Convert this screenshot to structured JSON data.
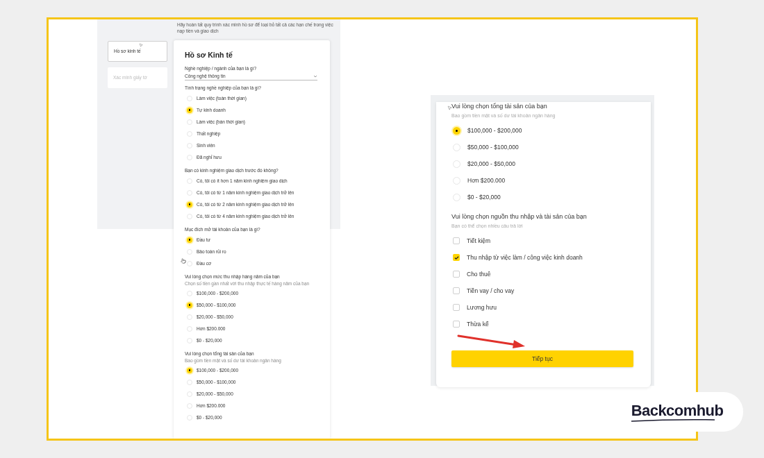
{
  "left_screen": {
    "intro": "Hãy hoàn tất quy trình xác minh hồ sơ để loại bỏ tất cả các hạn chế trong việc nạp tiền và giao dịch",
    "sidebar": [
      {
        "label": "Hồ sơ kinh tế",
        "selected": true
      },
      {
        "label": "Xác minh giấy tờ",
        "selected": false
      }
    ],
    "form": {
      "title": "Hồ sơ Kinh tế",
      "occupation": {
        "label": "Nghề nghiệp / ngành của bạn là gì?",
        "value": "Công nghệ thông tin"
      },
      "questions": [
        {
          "kind": "radio",
          "label": "Tình trạng nghề nghiệp của bạn là gì?",
          "options": [
            {
              "label": "Làm việc (toàn thời gian)",
              "selected": false
            },
            {
              "label": "Tự kinh doanh",
              "selected": true
            },
            {
              "label": "Làm việc (bán thời gian)",
              "selected": false
            },
            {
              "label": "Thất nghiệp",
              "selected": false
            },
            {
              "label": "Sinh viên",
              "selected": false
            },
            {
              "label": "Đã nghỉ hưu",
              "selected": false
            }
          ]
        },
        {
          "kind": "radio",
          "label": "Bạn có kinh nghiệm giao dịch trước đó không?",
          "options": [
            {
              "label": "Có, tôi có ít hơn 1 năm kinh nghiệm giao dịch",
              "selected": false
            },
            {
              "label": "Có, tôi có từ 1 năm kinh nghiệm giao dịch trở lên",
              "selected": false
            },
            {
              "label": "Có, tôi có từ 2 năm kinh nghiệm giao dịch trở lên",
              "selected": true
            },
            {
              "label": "Có, tôi có từ 4 năm kinh nghiệm giao dịch trở lên",
              "selected": false
            }
          ]
        },
        {
          "kind": "radio",
          "label": "Mục đích mở tài khoản của bạn là gì?",
          "options": [
            {
              "label": "Đầu tư",
              "selected": true
            },
            {
              "label": "Bảo toàn rủi ro",
              "selected": false
            },
            {
              "label": "Đầu cơ",
              "selected": false
            }
          ]
        },
        {
          "kind": "radio",
          "label": "Vui lòng chọn mức thu nhập hàng năm của bạn",
          "hint": "Chọn số tiền gần nhất với thu nhập thực tế hàng năm của bạn",
          "options": [
            {
              "label": "$100,000 - $200,000",
              "selected": false
            },
            {
              "label": "$50,000 - $100,000",
              "selected": true
            },
            {
              "label": "$20,000 - $50,000",
              "selected": false
            },
            {
              "label": "Hơn $200.000",
              "selected": false
            },
            {
              "label": "$0 - $20,000",
              "selected": false
            }
          ]
        },
        {
          "kind": "radio",
          "label": "Vui lòng chọn tổng tài sản của bạn",
          "hint": "Bao gồm tiền mặt và số dư tài khoản ngân hàng",
          "options": [
            {
              "label": "$100,000 - $200,000",
              "selected": true
            },
            {
              "label": "$50,000 - $100,000",
              "selected": false
            },
            {
              "label": "$20,000 - $50,000",
              "selected": false
            },
            {
              "label": "Hơn $200.000",
              "selected": false
            },
            {
              "label": "$0 - $20,000",
              "selected": false
            }
          ]
        }
      ]
    }
  },
  "right_screen": {
    "questions": [
      {
        "kind": "radio",
        "label": "Vui lòng chọn tổng tài sản của bạn",
        "hint": "Bao gồm tiền mặt và số dư tài khoản ngân hàng",
        "options": [
          {
            "label": "$100,000 - $200,000",
            "selected": true
          },
          {
            "label": "$50,000 - $100,000",
            "selected": false
          },
          {
            "label": "$20,000 - $50,000",
            "selected": false
          },
          {
            "label": "Hơn $200.000",
            "selected": false
          },
          {
            "label": "$0 - $20,000",
            "selected": false
          }
        ]
      },
      {
        "kind": "checkbox",
        "label": "Vui lòng chọn nguồn thu nhập và tài sản của bạn",
        "hint": "Bạn có thể chọn nhiều câu trả lời",
        "options": [
          {
            "label": "Tiết kiệm",
            "checked": false
          },
          {
            "label": "Thu nhập từ việc làm / công việc kinh doanh",
            "checked": true
          },
          {
            "label": "Cho thuê",
            "checked": false
          },
          {
            "label": "Tiền vay / cho vay",
            "checked": false
          },
          {
            "label": "Lương hưu",
            "checked": false
          },
          {
            "label": "Thừa kế",
            "checked": false
          }
        ]
      }
    ],
    "button": "Tiếp tục"
  },
  "logo": "Backcomhub"
}
